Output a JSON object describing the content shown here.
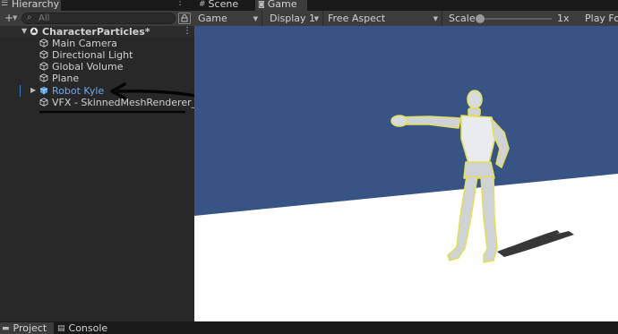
{
  "hierarchy": {
    "tab_label": "Hierarchy",
    "add_button": "+",
    "search_placeholder": "All",
    "scene": {
      "name": "CharacterParticles*"
    },
    "items": [
      {
        "label": "Main Camera"
      },
      {
        "label": "Directional Light"
      },
      {
        "label": "Global Volume"
      },
      {
        "label": "Plane"
      },
      {
        "label": "Robot Kyle",
        "selected": true
      },
      {
        "label": "VFX - SkinnedMeshRenderer_Sam"
      }
    ]
  },
  "top_tabs": {
    "scene": "Scene",
    "game": "Game"
  },
  "game_toolbar": {
    "display_mode": "Game",
    "display": "Display 1",
    "aspect": "Free Aspect",
    "scale_label": "Scale",
    "scale_value": "1x",
    "play_focused": "Play Fo"
  },
  "bottom_tabs": {
    "project": "Project",
    "console": "Console"
  },
  "colors": {
    "sky": "#385485",
    "ground": "#ffffff",
    "selected_text": "#6fa8f0",
    "selection_bar": "#3a79bb",
    "panel_bg": "#282828",
    "toolbar_bg": "#3c3c3c"
  },
  "icons": [
    "hamburger-icon",
    "plus-icon",
    "search-icon",
    "lock-icon",
    "unity-scene-icon",
    "gameobject-cube-icon",
    "prefab-cube-icon",
    "scene-tab-icon",
    "game-tab-icon",
    "project-folder-icon",
    "console-icon",
    "kebab-menu-icon"
  ]
}
